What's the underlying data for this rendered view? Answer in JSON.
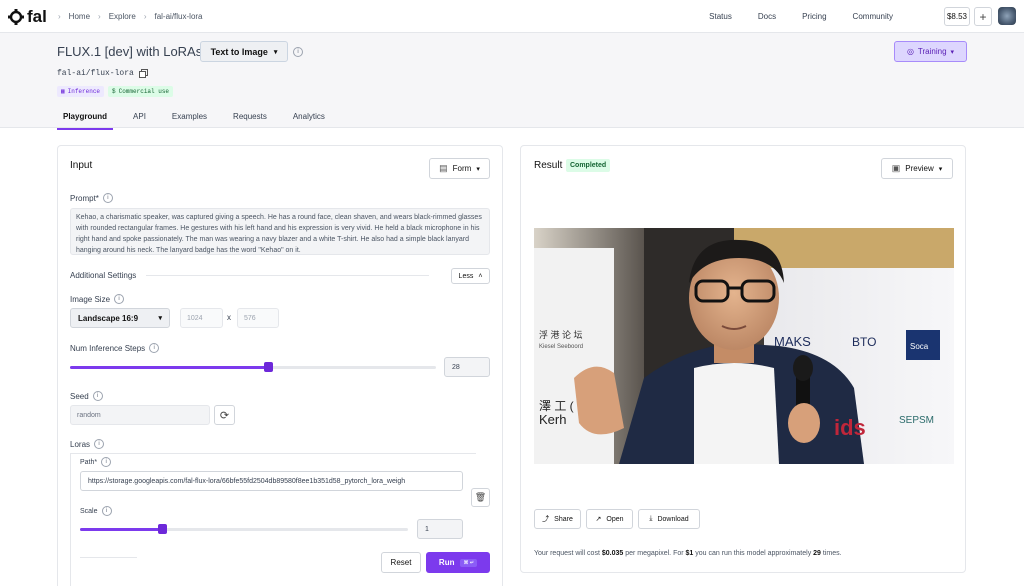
{
  "topbar": {
    "logo_text": "fal",
    "breadcrumbs": [
      "Home",
      "Explore",
      "fal-ai/flux-lora"
    ],
    "nav": [
      "Status",
      "Docs",
      "Pricing",
      "Community"
    ],
    "credits": "$8.53",
    "plus_label": "+"
  },
  "header": {
    "title": "FLUX.1 [dev] with LoRAs",
    "mode": "Text to Image",
    "model_id": "fal-ai/flux-lora",
    "badges": [
      "Inference",
      "Commercial use"
    ],
    "training_label": "Training",
    "tabs": [
      "Playground",
      "API",
      "Examples",
      "Requests",
      "Analytics"
    ]
  },
  "input": {
    "title": "Input",
    "form_label": "Form",
    "prompt_label": "Prompt*",
    "prompt_value": "Kehao, a charismatic speaker, was captured giving a speech. He has a round face, clean shaven, and wears black-rimmed glasses with rounded rectangular frames. He gestures with his left hand and his expression is very vivid. He held a black microphone in his right hand and spoke passionately. The man was wearing a navy blazer and a white T-shirt. He also had a simple black lanyard hanging around his neck. The lanyard badge has the word \"Kehao\" on it.",
    "additional_settings": "Additional Settings",
    "less_label": "Less",
    "image_size_label": "Image Size",
    "image_size_value": "Landscape 16:9",
    "width_value": "1024",
    "x_sep": "x",
    "height_value": "576",
    "steps_label": "Num Inference Steps",
    "steps_value": "28",
    "steps_fraction": 0.54,
    "seed_label": "Seed",
    "seed_placeholder": "random",
    "loras_label": "Loras",
    "path_label": "Path*",
    "path_value": "https://storage.googleapis.com/fal-flux-lora/66bfe55fd2504db89580f8ee1b351d58_pytorch_lora_weigh",
    "scale_label": "Scale",
    "scale_value": "1",
    "scale_fraction": 0.25,
    "reset_label": "Reset",
    "run_label": "Run",
    "run_shortcut": "⌘ ↵"
  },
  "result": {
    "title": "Result",
    "status": "Completed",
    "preview_label": "Preview",
    "share_label": "Share",
    "open_label": "Open",
    "download_label": "Download",
    "cost_pre": "Your request will cost ",
    "cost_price": "$0.035",
    "cost_mid": " per megapixel. For ",
    "cost_dollar": "$1",
    "cost_mid2": " you can run this model approximately ",
    "cost_times": "29",
    "cost_post": " times."
  },
  "photo": {
    "banner_left": "Kerh",
    "banner_chinese": "浮 港 论 坛",
    "banner_sub": "Kiesel Seeboord",
    "banner_chinese2": "澤 工 (",
    "sponsor1": "MAKS",
    "sponsor2": "BTO",
    "sponsor3": "Soca",
    "sponsor4": "SEPSM",
    "sponsor5": "ids"
  },
  "colors": {
    "accent": "#7c3aed",
    "status_green": "#dcfce7",
    "header_bg": "#f6f6f8"
  }
}
